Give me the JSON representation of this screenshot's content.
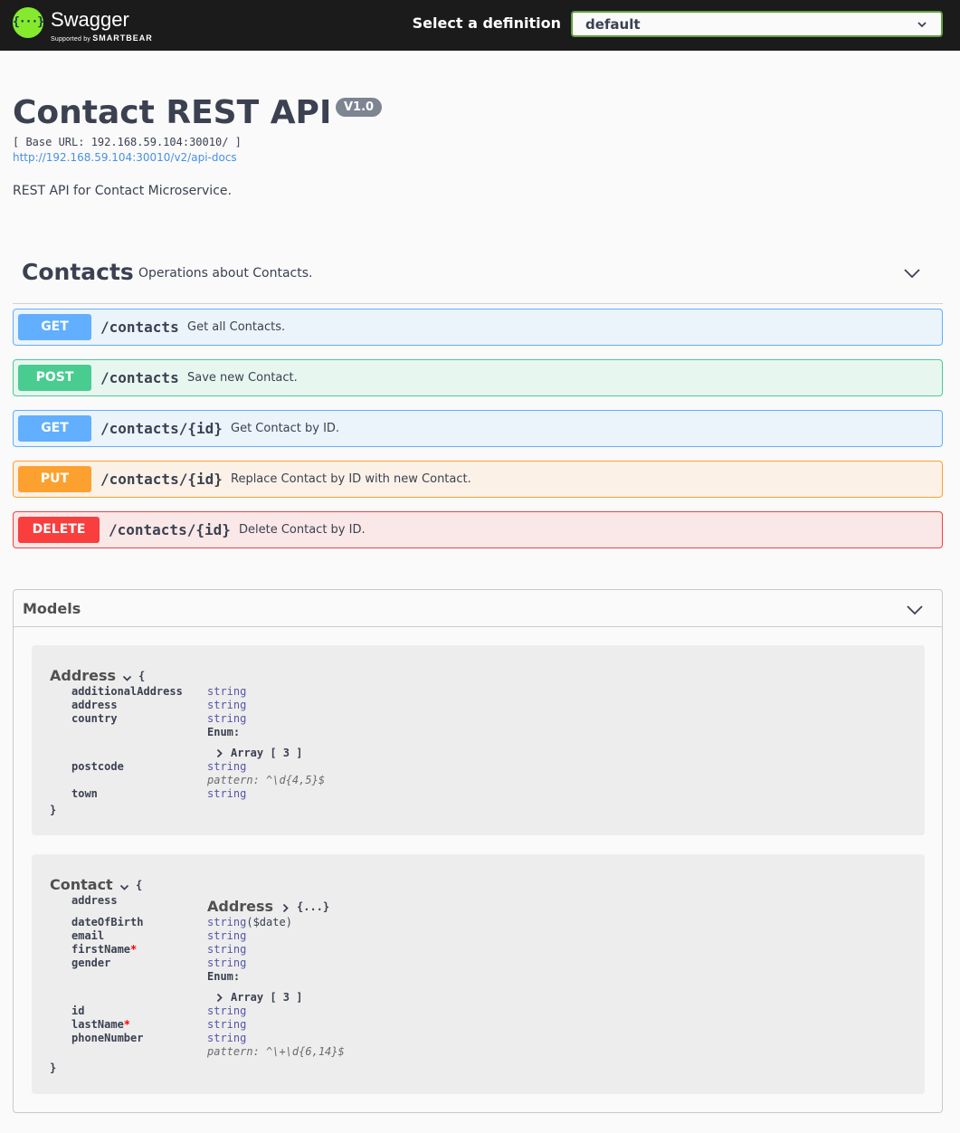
{
  "topbar": {
    "logo_word": "Swagger",
    "logo_sub_prefix": "Supported by",
    "logo_sub_brand": "SMARTBEAR",
    "definition_label": "Select a definition",
    "definition_value": "default"
  },
  "info": {
    "title": "Contact REST API",
    "version": "V1.0",
    "base_url": "[ Base URL: 192.168.59.104:30010/ ]",
    "docs_link": "http://192.168.59.104:30010/v2/api-docs",
    "description": "REST API for Contact Microservice."
  },
  "tag": {
    "name": "Contacts",
    "description": "Operations about Contacts."
  },
  "operations": [
    {
      "method": "GET",
      "path": "/contacts",
      "summary": "Get all Contacts."
    },
    {
      "method": "POST",
      "path": "/contacts",
      "summary": "Save new Contact."
    },
    {
      "method": "GET",
      "path": "/contacts/{id}",
      "summary": "Get Contact by ID."
    },
    {
      "method": "PUT",
      "path": "/contacts/{id}",
      "summary": "Replace Contact by ID with new Contact."
    },
    {
      "method": "DELETE",
      "path": "/contacts/{id}",
      "summary": "Delete Contact by ID."
    }
  ],
  "models": {
    "title": "Models",
    "open_brace": "{",
    "close_brace": "}",
    "required_mark": "*",
    "address": {
      "name": "Address",
      "props": [
        {
          "name": "additionalAddress",
          "type": "string"
        },
        {
          "name": "address",
          "type": "string"
        },
        {
          "name": "country",
          "type": "string",
          "enum_label": "Enum:",
          "array_label": "Array [ 3 ]"
        },
        {
          "name": "postcode",
          "type": "string",
          "pattern": "pattern: ^\\d{4,5}$"
        },
        {
          "name": "town",
          "type": "string"
        }
      ]
    },
    "contact": {
      "name": "Contact",
      "props": [
        {
          "name": "address",
          "ref_model": "Address",
          "ref_collapsed": "{...}"
        },
        {
          "name": "dateOfBirth",
          "type": "string",
          "format": "($date)"
        },
        {
          "name": "email",
          "type": "string"
        },
        {
          "name": "firstName",
          "type": "string",
          "required": true
        },
        {
          "name": "gender",
          "type": "string",
          "enum_label": "Enum:",
          "array_label": "Array [ 3 ]"
        },
        {
          "name": "id",
          "type": "string"
        },
        {
          "name": "lastName",
          "type": "string",
          "required": true
        },
        {
          "name": "phoneNumber",
          "type": "string",
          "pattern": "pattern: ^\\+\\d{6,14}$"
        }
      ]
    }
  },
  "colors": {
    "topbar_bg": "#1b1b1b",
    "logo_green": "#85ea2d",
    "get": "#61affe",
    "post": "#49cc90",
    "put": "#fca130",
    "delete": "#f93e3e",
    "type_color": "#5555aa"
  },
  "icons": {
    "logo": "swagger-logo-icon",
    "select_chevron": "chevron-down-icon",
    "tag_chevron": "chevron-down-icon",
    "models_chevron": "chevron-down-icon",
    "model_toggle": "chevron-down-icon",
    "array_toggle": "chevron-right-icon"
  }
}
